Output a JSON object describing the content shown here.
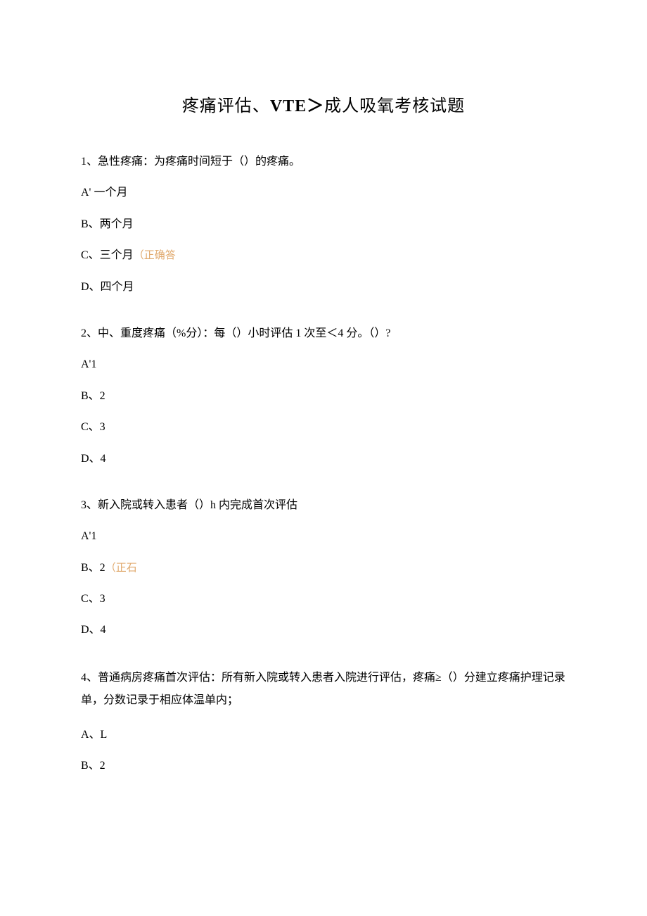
{
  "title_part1": "疼痛评估、",
  "title_bold": "VTE＞",
  "title_part2": "成人吸氧考核试题",
  "q1": {
    "text": "1、急性疼痛：为疼痛时间短于（）的疼痛。",
    "a": "A' 一个月",
    "b": "B、两个月",
    "c_label": "C、三个月",
    "c_correct": "（正确答",
    "d": "D、四个月"
  },
  "q2": {
    "text": "2、中、重度疼痛（%分）：每（）小时评估 1 次至＜4 分。（）?",
    "a": "A'1",
    "b": "B、2",
    "c": "C、3",
    "d": "D、4"
  },
  "q3": {
    "text": "3、新入院或转入患者（）h 内完成首次评估",
    "a": "A'1",
    "b_label": "B、2",
    "b_correct": "（正石",
    "c": "C、3",
    "d": "D、4"
  },
  "q4": {
    "text": "4、普通病房疼痛首次评估：所有新入院或转入患者入院进行评估，疼痛≥（）分建立疼痛护理记录单，分数记录于相应体温单内；",
    "a": "A、L",
    "b": "B、2"
  }
}
